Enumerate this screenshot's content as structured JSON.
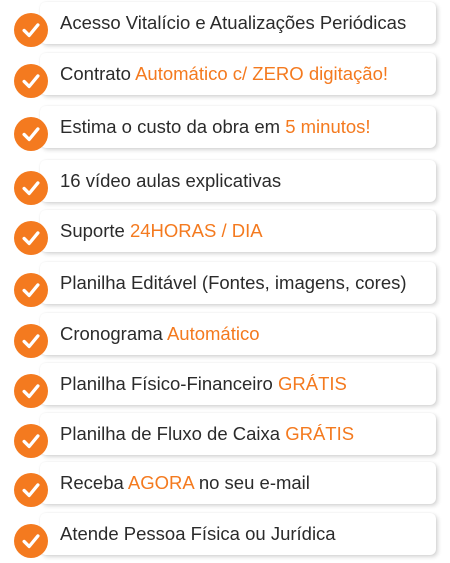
{
  "colors": {
    "accent": "#f47a1f",
    "text": "#2b2b2b"
  },
  "icon": "check-circle-icon",
  "items": [
    {
      "text": "Acesso Vitalício e Atualizações Periódicas",
      "highlight": "",
      "suffix": ""
    },
    {
      "text": "Contrato ",
      "highlight": "Automático c/ ZERO digitação!",
      "suffix": ""
    },
    {
      "text": "Estima o custo da obra em ",
      "highlight": "5 minutos!",
      "suffix": ""
    },
    {
      "text": "16 vídeo aulas explicativas",
      "highlight": "",
      "suffix": ""
    },
    {
      "text": "Suporte ",
      "highlight": "24HORAS / DIA",
      "suffix": ""
    },
    {
      "text": "Planilha Editável (Fontes, imagens, cores)",
      "highlight": "",
      "suffix": ""
    },
    {
      "text": "Cronograma ",
      "highlight": "Automático",
      "suffix": ""
    },
    {
      "text": "Planilha Físico-Financeiro ",
      "highlight": "GRÁTIS",
      "suffix": ""
    },
    {
      "text": "Planilha de Fluxo de Caixa ",
      "highlight": "GRÁTIS",
      "suffix": ""
    },
    {
      "text": "Receba ",
      "highlight": "AGORA",
      "suffix": " no seu e-mail"
    },
    {
      "text": "Atende Pessoa Física ou Jurídica",
      "highlight": "",
      "suffix": ""
    }
  ]
}
